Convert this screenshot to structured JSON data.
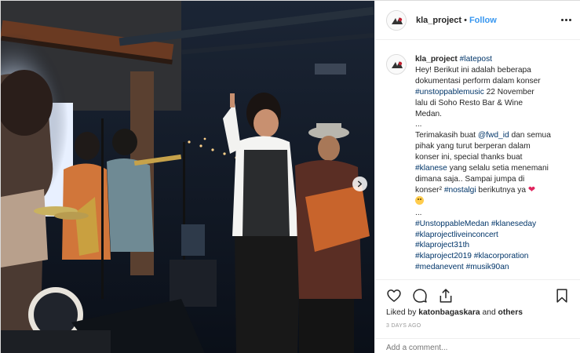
{
  "post": {
    "username": "kla_project",
    "follow_label": "Follow",
    "dot": "•"
  },
  "caption": {
    "username": "kla_project",
    "lines": [
      [
        "#latepost"
      ],
      [
        "Hey! Berikut ini adalah beberapa"
      ],
      [
        "dokumentasi perform dalam konser"
      ],
      [
        "#unstoppablemusic",
        " 22 November"
      ],
      [
        "lalu di Soho Resto Bar & Wine"
      ],
      [
        "Medan."
      ],
      [
        "..."
      ],
      [
        "Terimakasih buat ",
        "@fwd_id",
        " dan semua"
      ],
      [
        "pihak yang turut berperan dalam"
      ],
      [
        "konser ini, special thanks buat"
      ],
      [
        "#klanese",
        " yang selalu setia menemani"
      ],
      [
        "dimana saja.. Sampai jumpa di"
      ],
      [
        "konser² ",
        "#nostalgi",
        " berikutnya ya "
      ],
      [
        ""
      ],
      [
        "..."
      ],
      [
        "#UnstoppableMedan",
        " ",
        "#klaneseday"
      ],
      [
        "#klaprojectliveinconcert"
      ],
      [
        "#klaproject31th"
      ],
      [
        "#klaproject2019",
        " ",
        "#klacorporation"
      ],
      [
        "#medanevent",
        " ",
        "#musik90an"
      ]
    ]
  },
  "likes": {
    "prefix": "Liked by ",
    "user": "katonbagaskara",
    "and": " and ",
    "others": "others"
  },
  "timestamp": "3 DAYS AGO",
  "comment": {
    "placeholder": "Add a comment..."
  },
  "icons": {
    "like": "heart-outline-icon",
    "comment": "comment-bubble-icon",
    "share": "share-icon",
    "save": "bookmark-icon",
    "next": "chevron-right-icon",
    "more": "more-options-icon"
  },
  "colors": {
    "link": "#003569",
    "follow": "#3897f0",
    "heart": "#e0245e",
    "timestamp": "#999999"
  }
}
